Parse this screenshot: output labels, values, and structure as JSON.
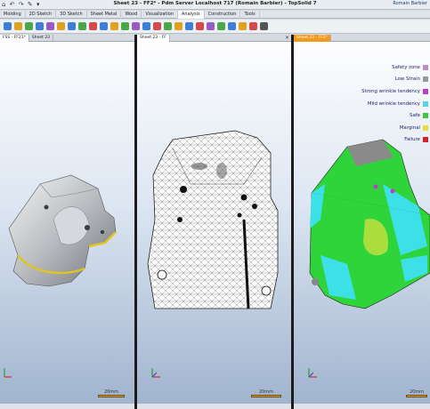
{
  "titlebar": {
    "quick_access": "⌂ ↶ ↷ ✎ ▾",
    "title": "Sheet 23 - FF2* - Pdm Server Localhost 717 (Romain Barbier) - TopSolid 7",
    "user": "Romain Barbier"
  },
  "ribbon": {
    "tabs": [
      "Molding",
      "2D Sketch",
      "3D Sketch",
      "Sheet Metal",
      "Wood",
      "Visualization",
      "Analysis",
      "Construction",
      "Tools"
    ],
    "active": "Analysis"
  },
  "toolbar": {
    "icons": [
      "part-icon",
      "assembly-icon",
      "sketch-icon",
      "shape-icon",
      "surface-icon",
      "curve-icon",
      "point-icon",
      "measure-icon",
      "sheet-icon",
      "fold-icon",
      "unfold-icon",
      "bend-icon",
      "draft-icon",
      "section-icon",
      "analysis-icon",
      "mesh-icon",
      "stamp-icon",
      "check-icon",
      "color-icon",
      "material-icon",
      "feasibility-icon",
      "thickness-icon",
      "strain-icon",
      "wrinkle-icon",
      "settings-icon"
    ],
    "icon_colors": [
      "#3d7fd6",
      "#e0a020",
      "#4aa84a",
      "#3d7fd6",
      "#9a59c4",
      "#e0a020",
      "#3d7fd6",
      "#4aa84a",
      "#d64a4a",
      "#3d7fd6",
      "#e0a020",
      "#4aa84a",
      "#9a59c4",
      "#3d7fd6",
      "#d64a4a",
      "#4aa84a",
      "#e0a020",
      "#3d7fd6",
      "#d64a4a",
      "#9a59c4",
      "#4aa84a",
      "#3d7fd6",
      "#e0a020",
      "#d64a4a",
      "#555555"
    ]
  },
  "panes": [
    {
      "tabs": [
        "FSS - FF21*",
        "Sheet 23"
      ],
      "active_tab": 0,
      "scale_label": "20mm"
    },
    {
      "tabs": [
        "Sheet 23 - FF"
      ],
      "active_tab": 0,
      "scale_label": "20mm"
    },
    {
      "tabs": [
        "Sheet 23 - FF2*"
      ],
      "active_tab": 0,
      "scale_label": "20mm",
      "legend": [
        {
          "label": "Safety zone",
          "color": "#c08ad0"
        },
        {
          "label": "Low Strain",
          "color": "#9a9a9a"
        },
        {
          "label": "Strong wrinkle tendency",
          "color": "#c03ad0"
        },
        {
          "label": "Mild wrinkle tendency",
          "color": "#4fd6e4"
        },
        {
          "label": "Safe",
          "color": "#3ac83a"
        },
        {
          "label": "Marginal",
          "color": "#e8e030"
        },
        {
          "label": "Failure",
          "color": "#e02020"
        }
      ]
    }
  ],
  "close_glyph": "×"
}
